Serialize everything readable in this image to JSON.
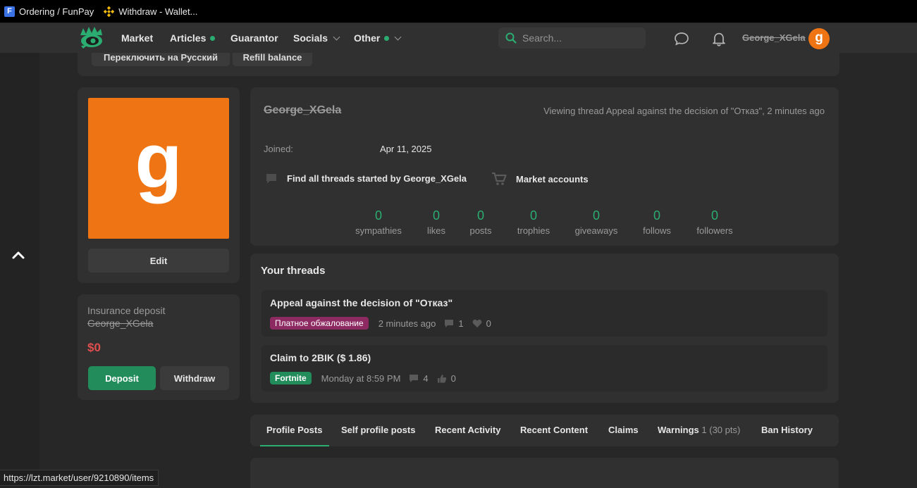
{
  "browser": {
    "bookmarks": [
      {
        "label": "Ordering / FunPay",
        "icon": "funpay-icon"
      },
      {
        "label": "Withdraw - Wallet...",
        "icon": "binance-icon"
      }
    ],
    "status_url": "https://lzt.market/user/9210890/items"
  },
  "nav": {
    "items": [
      {
        "label": "Market"
      },
      {
        "label": "Articles"
      },
      {
        "label": "Guarantor"
      },
      {
        "label": "Socials"
      },
      {
        "label": "Other"
      }
    ],
    "search_placeholder": "Search...",
    "username": "George_XGela",
    "avatar_letter": "g"
  },
  "top_strip": {
    "btn_russian": "Переключить на Русский",
    "btn_refill": "Refill balance"
  },
  "sidebar": {
    "avatar_letter": "g",
    "edit_label": "Edit",
    "deposit_title": "Insurance deposit",
    "deposit_user": "George_XGela",
    "deposit_amount": "$0",
    "deposit_btn": "Deposit",
    "withdraw_btn": "Withdraw"
  },
  "profile": {
    "name": "George_XGela",
    "viewing": "Viewing thread Appeal against the decision of \"Отказ\", 2 minutes ago",
    "joined_label": "Joined:",
    "joined_value": "Apr 11, 2025",
    "find_threads": "Find all threads started by George_XGela",
    "market_accounts": "Market accounts",
    "stats": [
      {
        "value": "0",
        "label": "sympathies"
      },
      {
        "value": "0",
        "label": "likes"
      },
      {
        "value": "0",
        "label": "posts"
      },
      {
        "value": "0",
        "label": "trophies"
      },
      {
        "value": "0",
        "label": "giveaways"
      },
      {
        "value": "0",
        "label": "follows"
      },
      {
        "value": "0",
        "label": "followers"
      }
    ]
  },
  "threads": {
    "title": "Your threads",
    "items": [
      {
        "title": "Appeal against the decision of \"Отказ\"",
        "tag": "Платное обжалование",
        "time": "2 minutes ago",
        "replies": "1",
        "likes": "0"
      },
      {
        "title": "Claim to 2BIK ($ 1.86)",
        "tag": "Fortnite",
        "time": "Monday at 8:59 PM",
        "replies": "4",
        "likes": "0"
      }
    ]
  },
  "tabs": {
    "profile_posts": "Profile Posts",
    "self_profile_posts": "Self profile posts",
    "recent_activity": "Recent Activity",
    "recent_content": "Recent Content",
    "claims": "Claims",
    "warnings": "Warnings",
    "warnings_count": "1",
    "warnings_pts": "(30 pts)",
    "ban_history": "Ban History"
  },
  "colors": {
    "accent_green": "#2bad72",
    "avatar_orange": "#ef7514",
    "deposit_red": "#e04e4e",
    "tag_pink": "#8d2a62"
  }
}
